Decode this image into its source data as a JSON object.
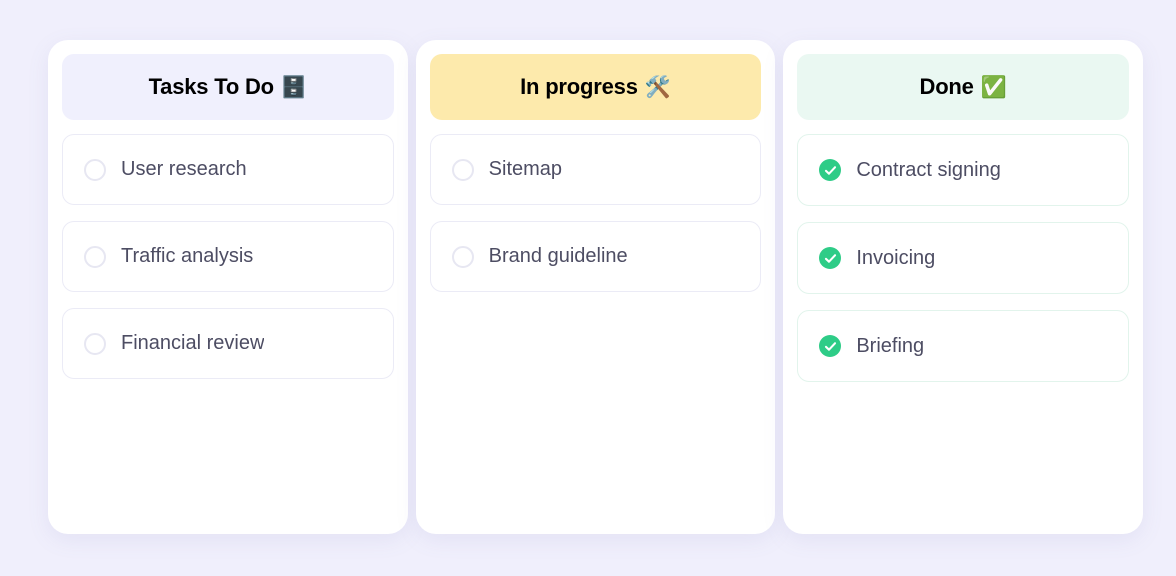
{
  "board": {
    "background_color": "#f0effc",
    "columns": [
      {
        "id": "todo",
        "title": "Tasks To Do",
        "emoji": "🗄️",
        "emoji_name": "file-cabinet-emoji",
        "header_color": "#f0f0fd",
        "cards": [
          {
            "label": "User research",
            "checked": false
          },
          {
            "label": "Traffic analysis",
            "checked": false
          },
          {
            "label": "Financial review",
            "checked": false
          }
        ]
      },
      {
        "id": "progress",
        "title": "In progress",
        "emoji": "🛠️",
        "emoji_name": "hammer-and-wrench-emoji",
        "header_color": "#fdeaac",
        "cards": [
          {
            "label": "Sitemap",
            "checked": false
          },
          {
            "label": "Brand guideline",
            "checked": false
          }
        ]
      },
      {
        "id": "done",
        "title": "Done",
        "emoji": "✅",
        "emoji_name": "check-mark-button-emoji",
        "header_color": "#eaf8f2",
        "cards": [
          {
            "label": "Contract signing",
            "checked": true
          },
          {
            "label": "Invoicing",
            "checked": true
          },
          {
            "label": "Briefing",
            "checked": true
          }
        ]
      }
    ]
  },
  "colors": {
    "check_green": "#2ecc87",
    "card_border": "#ebebf6",
    "card_border_done": "#e2f4ec",
    "task_text": "#4d4d63"
  }
}
